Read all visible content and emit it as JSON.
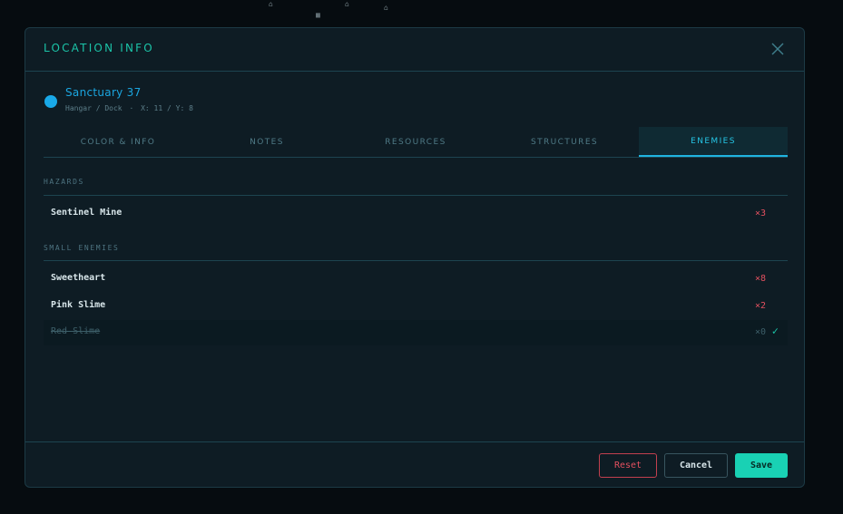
{
  "modal": {
    "title": "LOCATION INFO",
    "location": {
      "name": "Sanctuary 37",
      "type": "Hangar / Dock",
      "separator": "·",
      "coords": "X: 11 / Y: 8",
      "dot_color": "#19a9e8"
    },
    "tabs": [
      {
        "label": "COLOR & INFO",
        "active": false
      },
      {
        "label": "NOTES",
        "active": false
      },
      {
        "label": "RESOURCES",
        "active": false
      },
      {
        "label": "STRUCTURES",
        "active": false
      },
      {
        "label": "ENEMIES",
        "active": true
      }
    ],
    "sections": [
      {
        "label": "HAZARDS",
        "items": [
          {
            "name": "Sentinel Mine",
            "count": "×3",
            "done": false
          }
        ]
      },
      {
        "label": "SMALL ENEMIES",
        "items": [
          {
            "name": "Sweetheart",
            "count": "×8",
            "done": false
          },
          {
            "name": "Pink Slime",
            "count": "×2",
            "done": false
          },
          {
            "name": "Red Slime",
            "count": "×0",
            "done": true,
            "check": "✓"
          }
        ]
      }
    ],
    "footer": {
      "reset_label": "Reset",
      "cancel_label": "Cancel",
      "save_label": "Save"
    }
  },
  "colors": {
    "accent": "#1bc4a8",
    "tab_active": "#26c6e6",
    "danger": "#e2505f",
    "save_bg": "#19d1b4"
  },
  "icons": {
    "close": "close-icon",
    "check": "check-icon"
  }
}
